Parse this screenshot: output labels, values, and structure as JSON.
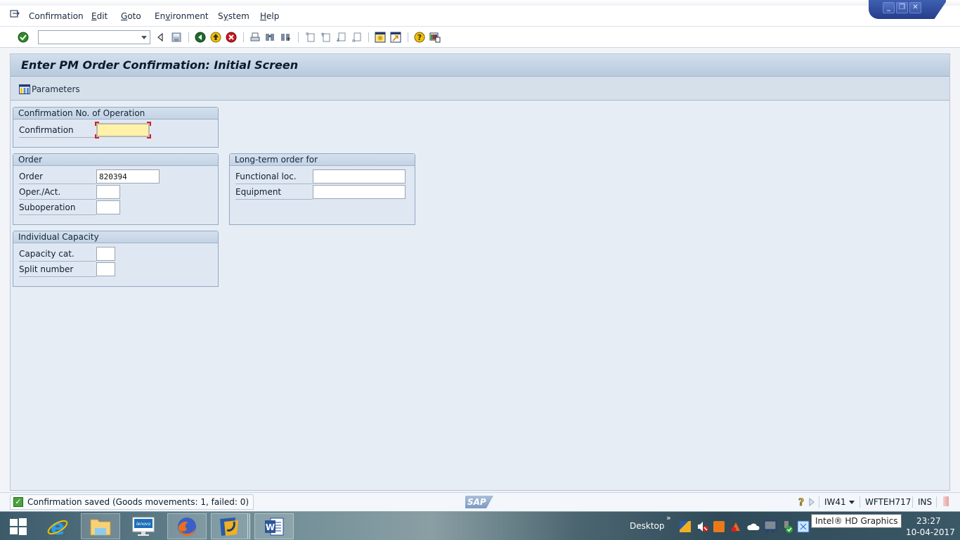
{
  "menubar": {
    "items": [
      {
        "label": "Confirmation",
        "mnemonic_index": 4
      },
      {
        "label": "Edit",
        "mnemonic_index": 0
      },
      {
        "label": "Goto",
        "mnemonic_index": 0
      },
      {
        "label": "Environment",
        "mnemonic_index": 2
      },
      {
        "label": "System",
        "mnemonic_index": 1
      },
      {
        "label": "Help",
        "mnemonic_index": 0
      }
    ]
  },
  "window_controls": {
    "minimize": "_",
    "restore": "❐",
    "close": "✕"
  },
  "toolbar": {
    "command_field_value": "",
    "icons": [
      "enter-check-icon",
      "back-triangle-icon",
      "save-icon",
      "back-icon",
      "exit-icon",
      "cancel-icon",
      "print-icon",
      "find-icon",
      "find-next-icon",
      "first-page-icon",
      "previous-page-icon",
      "next-page-icon",
      "last-page-icon",
      "create-session-icon",
      "create-shortcut-icon",
      "help-icon",
      "layout-menu-icon"
    ]
  },
  "screen": {
    "title": "Enter PM Order Confirmation: Initial Screen",
    "app_toolbar": {
      "parameters_label": "Parameters"
    }
  },
  "groups": {
    "confirmation_no": {
      "title": "Confirmation No. of Operation",
      "fields": [
        {
          "label": "Confirmation",
          "value": ""
        }
      ]
    },
    "order": {
      "title": "Order",
      "fields": [
        {
          "label": "Order",
          "value": "820394"
        },
        {
          "label": "Oper./Act.",
          "value": ""
        },
        {
          "label": "Suboperation",
          "value": ""
        }
      ]
    },
    "long_term": {
      "title": "Long-term order for",
      "fields": [
        {
          "label": "Functional loc.",
          "value": ""
        },
        {
          "label": "Equipment",
          "value": ""
        }
      ]
    },
    "capacity": {
      "title": "Individual Capacity",
      "fields": [
        {
          "label": "Capacity cat.",
          "value": ""
        },
        {
          "label": "Split number",
          "value": ""
        }
      ]
    }
  },
  "statusbar": {
    "message": "Confirmation saved (Goods movements: 1, failed: 0)",
    "message_type": "success",
    "logo": "SAP",
    "transaction": "IW41",
    "system": "WFTEH717",
    "mode": "INS"
  },
  "taskbar": {
    "apps": [
      "windows-start",
      "internet-explorer",
      "file-explorer",
      "lenovo",
      "firefox",
      "sap-logon",
      "microsoft-word"
    ],
    "desktop_label": "Desktop",
    "overflow_label": "»",
    "tooltip": "Intel® HD Graphics",
    "time": "23:27",
    "date": "10-04-2017"
  },
  "colors": {
    "screen_bg": "#e6edf5",
    "title_bar": "#c3d3e5",
    "required_field": "#fff1a8",
    "focus_corner": "#d3202a",
    "success_green": "#48a33c"
  }
}
